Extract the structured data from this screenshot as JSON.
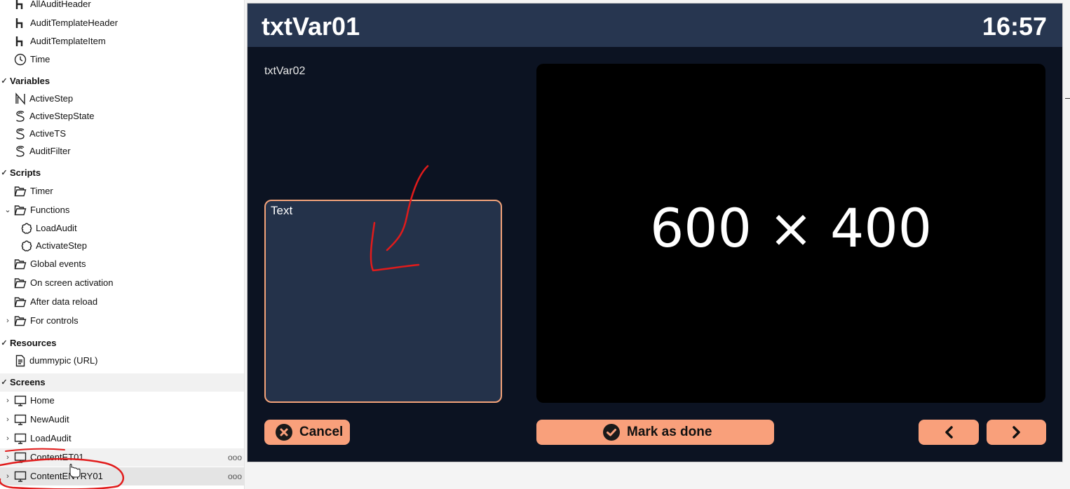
{
  "tree": {
    "top_items": [
      {
        "label": "AllAuditHeader",
        "icon": "h-icon"
      },
      {
        "label": "AuditTemplateHeader",
        "icon": "h-icon"
      },
      {
        "label": "AuditTemplateItem",
        "icon": "h-icon"
      },
      {
        "label": "Time",
        "icon": "clock-icon"
      }
    ],
    "variables": {
      "title": "Variables",
      "items": [
        {
          "label": "ActiveStep",
          "icon": "n-icon"
        },
        {
          "label": "ActiveStepState",
          "icon": "s-icon"
        },
        {
          "label": "ActiveTS",
          "icon": "s-icon"
        },
        {
          "label": "AuditFilter",
          "icon": "s-icon"
        }
      ]
    },
    "scripts": {
      "title": "Scripts",
      "items": [
        {
          "label": "Timer",
          "icon": "folder-icon"
        },
        {
          "label": "Functions",
          "icon": "folder-icon"
        },
        {
          "label": "LoadAudit",
          "icon": "function-icon"
        },
        {
          "label": "ActivateStep",
          "icon": "function-icon"
        },
        {
          "label": "Global events",
          "icon": "folder-icon"
        },
        {
          "label": "On screen activation",
          "icon": "folder-icon"
        },
        {
          "label": "After data reload",
          "icon": "folder-icon"
        },
        {
          "label": "For controls",
          "icon": "folder-icon"
        }
      ]
    },
    "resources": {
      "title": "Resources",
      "items": [
        {
          "label": "dummypic (URL)",
          "icon": "document-icon"
        }
      ]
    },
    "screens": {
      "title": "Screens",
      "items": [
        {
          "label": "Home",
          "icon": "monitor-icon"
        },
        {
          "label": "NewAudit",
          "icon": "monitor-icon"
        },
        {
          "label": "LoadAudit",
          "icon": "monitor-icon"
        },
        {
          "label": "ContentET01",
          "icon": "monitor-icon",
          "more": "ooo"
        },
        {
          "label": "ContentENTRY01",
          "icon": "monitor-icon",
          "more": "ooo"
        }
      ]
    }
  },
  "preview": {
    "title": "txtVar01",
    "clock": "16:57",
    "subtitle": "txtVar02",
    "textbox_label": "Text",
    "image_placeholder": "600 × 400",
    "cancel_label": "Cancel",
    "done_label": "Mark as done",
    "colors": {
      "header": "#273650",
      "background": "#0c1322",
      "accent": "#f9a07b",
      "textbox": "#24324a"
    }
  }
}
